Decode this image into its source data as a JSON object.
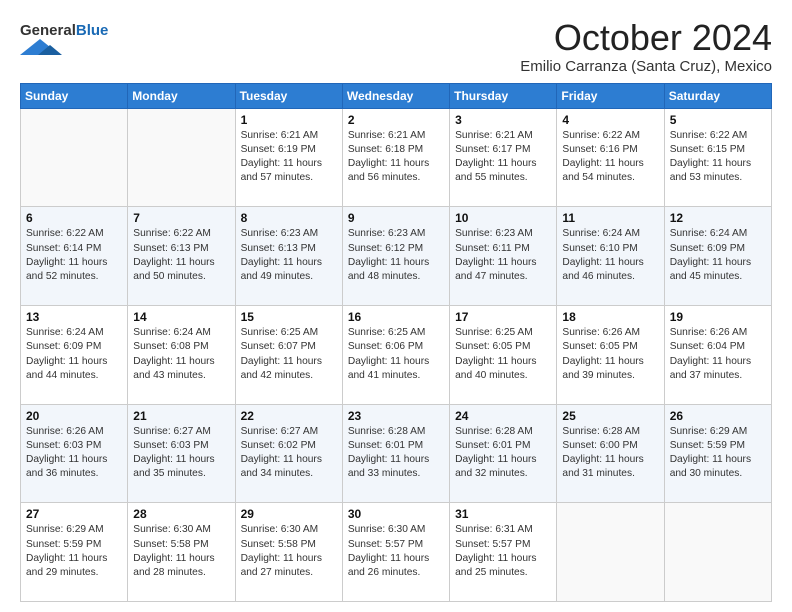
{
  "header": {
    "logo_general": "General",
    "logo_blue": "Blue",
    "month_title": "October 2024",
    "location": "Emilio Carranza (Santa Cruz), Mexico"
  },
  "days_of_week": [
    "Sunday",
    "Monday",
    "Tuesday",
    "Wednesday",
    "Thursday",
    "Friday",
    "Saturday"
  ],
  "weeks": [
    [
      {
        "day": "",
        "sunrise": "",
        "sunset": "",
        "daylight": ""
      },
      {
        "day": "",
        "sunrise": "",
        "sunset": "",
        "daylight": ""
      },
      {
        "day": "1",
        "sunrise": "Sunrise: 6:21 AM",
        "sunset": "Sunset: 6:19 PM",
        "daylight": "Daylight: 11 hours and 57 minutes."
      },
      {
        "day": "2",
        "sunrise": "Sunrise: 6:21 AM",
        "sunset": "Sunset: 6:18 PM",
        "daylight": "Daylight: 11 hours and 56 minutes."
      },
      {
        "day": "3",
        "sunrise": "Sunrise: 6:21 AM",
        "sunset": "Sunset: 6:17 PM",
        "daylight": "Daylight: 11 hours and 55 minutes."
      },
      {
        "day": "4",
        "sunrise": "Sunrise: 6:22 AM",
        "sunset": "Sunset: 6:16 PM",
        "daylight": "Daylight: 11 hours and 54 minutes."
      },
      {
        "day": "5",
        "sunrise": "Sunrise: 6:22 AM",
        "sunset": "Sunset: 6:15 PM",
        "daylight": "Daylight: 11 hours and 53 minutes."
      }
    ],
    [
      {
        "day": "6",
        "sunrise": "Sunrise: 6:22 AM",
        "sunset": "Sunset: 6:14 PM",
        "daylight": "Daylight: 11 hours and 52 minutes."
      },
      {
        "day": "7",
        "sunrise": "Sunrise: 6:22 AM",
        "sunset": "Sunset: 6:13 PM",
        "daylight": "Daylight: 11 hours and 50 minutes."
      },
      {
        "day": "8",
        "sunrise": "Sunrise: 6:23 AM",
        "sunset": "Sunset: 6:13 PM",
        "daylight": "Daylight: 11 hours and 49 minutes."
      },
      {
        "day": "9",
        "sunrise": "Sunrise: 6:23 AM",
        "sunset": "Sunset: 6:12 PM",
        "daylight": "Daylight: 11 hours and 48 minutes."
      },
      {
        "day": "10",
        "sunrise": "Sunrise: 6:23 AM",
        "sunset": "Sunset: 6:11 PM",
        "daylight": "Daylight: 11 hours and 47 minutes."
      },
      {
        "day": "11",
        "sunrise": "Sunrise: 6:24 AM",
        "sunset": "Sunset: 6:10 PM",
        "daylight": "Daylight: 11 hours and 46 minutes."
      },
      {
        "day": "12",
        "sunrise": "Sunrise: 6:24 AM",
        "sunset": "Sunset: 6:09 PM",
        "daylight": "Daylight: 11 hours and 45 minutes."
      }
    ],
    [
      {
        "day": "13",
        "sunrise": "Sunrise: 6:24 AM",
        "sunset": "Sunset: 6:09 PM",
        "daylight": "Daylight: 11 hours and 44 minutes."
      },
      {
        "day": "14",
        "sunrise": "Sunrise: 6:24 AM",
        "sunset": "Sunset: 6:08 PM",
        "daylight": "Daylight: 11 hours and 43 minutes."
      },
      {
        "day": "15",
        "sunrise": "Sunrise: 6:25 AM",
        "sunset": "Sunset: 6:07 PM",
        "daylight": "Daylight: 11 hours and 42 minutes."
      },
      {
        "day": "16",
        "sunrise": "Sunrise: 6:25 AM",
        "sunset": "Sunset: 6:06 PM",
        "daylight": "Daylight: 11 hours and 41 minutes."
      },
      {
        "day": "17",
        "sunrise": "Sunrise: 6:25 AM",
        "sunset": "Sunset: 6:05 PM",
        "daylight": "Daylight: 11 hours and 40 minutes."
      },
      {
        "day": "18",
        "sunrise": "Sunrise: 6:26 AM",
        "sunset": "Sunset: 6:05 PM",
        "daylight": "Daylight: 11 hours and 39 minutes."
      },
      {
        "day": "19",
        "sunrise": "Sunrise: 6:26 AM",
        "sunset": "Sunset: 6:04 PM",
        "daylight": "Daylight: 11 hours and 37 minutes."
      }
    ],
    [
      {
        "day": "20",
        "sunrise": "Sunrise: 6:26 AM",
        "sunset": "Sunset: 6:03 PM",
        "daylight": "Daylight: 11 hours and 36 minutes."
      },
      {
        "day": "21",
        "sunrise": "Sunrise: 6:27 AM",
        "sunset": "Sunset: 6:03 PM",
        "daylight": "Daylight: 11 hours and 35 minutes."
      },
      {
        "day": "22",
        "sunrise": "Sunrise: 6:27 AM",
        "sunset": "Sunset: 6:02 PM",
        "daylight": "Daylight: 11 hours and 34 minutes."
      },
      {
        "day": "23",
        "sunrise": "Sunrise: 6:28 AM",
        "sunset": "Sunset: 6:01 PM",
        "daylight": "Daylight: 11 hours and 33 minutes."
      },
      {
        "day": "24",
        "sunrise": "Sunrise: 6:28 AM",
        "sunset": "Sunset: 6:01 PM",
        "daylight": "Daylight: 11 hours and 32 minutes."
      },
      {
        "day": "25",
        "sunrise": "Sunrise: 6:28 AM",
        "sunset": "Sunset: 6:00 PM",
        "daylight": "Daylight: 11 hours and 31 minutes."
      },
      {
        "day": "26",
        "sunrise": "Sunrise: 6:29 AM",
        "sunset": "Sunset: 5:59 PM",
        "daylight": "Daylight: 11 hours and 30 minutes."
      }
    ],
    [
      {
        "day": "27",
        "sunrise": "Sunrise: 6:29 AM",
        "sunset": "Sunset: 5:59 PM",
        "daylight": "Daylight: 11 hours and 29 minutes."
      },
      {
        "day": "28",
        "sunrise": "Sunrise: 6:30 AM",
        "sunset": "Sunset: 5:58 PM",
        "daylight": "Daylight: 11 hours and 28 minutes."
      },
      {
        "day": "29",
        "sunrise": "Sunrise: 6:30 AM",
        "sunset": "Sunset: 5:58 PM",
        "daylight": "Daylight: 11 hours and 27 minutes."
      },
      {
        "day": "30",
        "sunrise": "Sunrise: 6:30 AM",
        "sunset": "Sunset: 5:57 PM",
        "daylight": "Daylight: 11 hours and 26 minutes."
      },
      {
        "day": "31",
        "sunrise": "Sunrise: 6:31 AM",
        "sunset": "Sunset: 5:57 PM",
        "daylight": "Daylight: 11 hours and 25 minutes."
      },
      {
        "day": "",
        "sunrise": "",
        "sunset": "",
        "daylight": ""
      },
      {
        "day": "",
        "sunrise": "",
        "sunset": "",
        "daylight": ""
      }
    ]
  ]
}
